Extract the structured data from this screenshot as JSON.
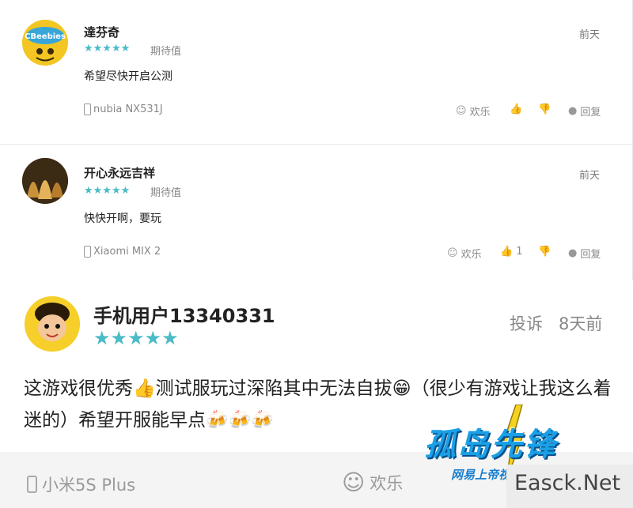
{
  "reviews": [
    {
      "user": "達芬奇",
      "stars": "★★★★★",
      "badge": "期待值",
      "time": "前天",
      "text": "希望尽快开启公测",
      "device": "nubia NX531J",
      "emotion": "欢乐",
      "likes": "",
      "reply": "回复",
      "avatar_text": "CBeebies"
    },
    {
      "user": "开心永远吉祥",
      "stars": "★★★★★",
      "badge": "期待值",
      "time": "前天",
      "text": "快快开啊，要玩",
      "device": "Xiaomi MIX 2",
      "emotion": "欢乐",
      "likes": "1",
      "reply": "回复"
    }
  ],
  "featured": {
    "user": "手机用户13340331",
    "stars": "★★★★★",
    "complain": "投诉",
    "time": "8天前",
    "text_part1": "这游戏很优秀",
    "text_part2": "测试服玩过深陷其中无法自拔",
    "text_part3": "（很少有游戏让我这么着迷的）希望开服能早点",
    "device": "小米5S Plus",
    "emotion": "欢乐"
  },
  "watermark": {
    "logo": "孤岛先锋",
    "subtitle": "网易上帝视角",
    "site": "Easck.Net"
  },
  "colors": {
    "star": "#4bbbc6",
    "watermark_blue": "#1aa0e6"
  },
  "icons": {
    "phone": "phone-icon",
    "smile": "smile-icon",
    "thumb_up": "thumb-up-icon",
    "thumb_down": "thumb-down-icon",
    "reply": "comment-icon"
  }
}
